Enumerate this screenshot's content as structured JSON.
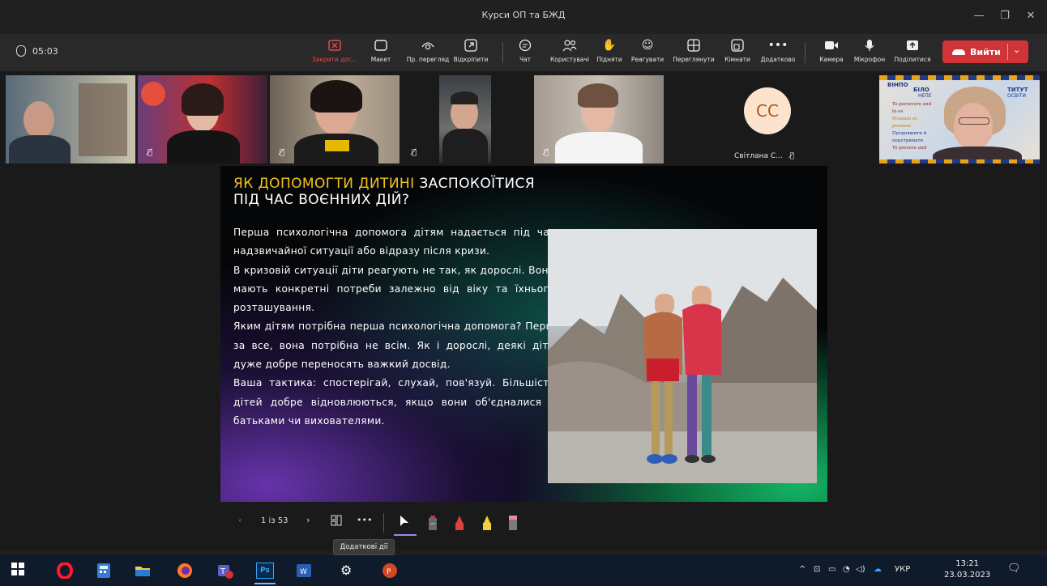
{
  "window": {
    "title": "Курси ОП та БЖД",
    "minimize": "—",
    "maximize": "❐",
    "close": "✕"
  },
  "meeting": {
    "timer": "05:03"
  },
  "toolbar": {
    "buttons": [
      {
        "label": "Закрити дос...",
        "icon": "close-share-icon"
      },
      {
        "label": "Макет",
        "icon": "layout-icon"
      },
      {
        "label": "Пр. перегляд",
        "icon": "preview-icon"
      },
      {
        "label": "Відкріпити",
        "icon": "popout-icon"
      },
      {
        "label": "Чат",
        "icon": "chat-icon"
      },
      {
        "label": "Користувачі",
        "icon": "people-icon"
      },
      {
        "label": "Підняти",
        "icon": "raise-hand-icon"
      },
      {
        "label": "Реагувати",
        "icon": "react-icon"
      },
      {
        "label": "Переглянути",
        "icon": "view-icon"
      },
      {
        "label": "Кімнати",
        "icon": "rooms-icon"
      },
      {
        "label": "Додатково",
        "icon": "more-icon"
      },
      {
        "label": "Камера",
        "icon": "camera-icon"
      },
      {
        "label": "Мікрофон",
        "icon": "mic-icon"
      },
      {
        "label": "Поділитися",
        "icon": "share-icon"
      }
    ],
    "leave_label": "Вийти",
    "leave_color": "#d13438"
  },
  "participants": {
    "avatar_initials": "CC",
    "avatar_name": "Світлана С...",
    "presenter_banner": "ВІНПО",
    "presenter_banner_2": "БІЛО",
    "presenter_banner_3": "ТИТУТ",
    "presenter_banner_4": "НЕПЕ",
    "presenter_banner_5": "ОСВІТИ",
    "presenter_slide_lines": [
      "To persevere and to es",
      "Prosiare ei, prosiare",
      "Продовжити й перетримати",
      "To perseve and"
    ]
  },
  "slide": {
    "title_highlight": "ЯК ДОПОМОГТИ ДИТИНІ",
    "title_rest": " ЗАСПОКОЇТИСЯ",
    "title_line2": "ПІД ЧАС ВОЄННИХ ДІЙ?",
    "paragraphs": [
      "Перша психологічна допомога дітям надається під час надзвичайної ситуації або відразу після кризи.",
      "В кризовій ситуації діти реагують не так, як дорослі. Вони мають конкретні потреби залежно від віку та їхнього розташування.",
      "Яким дітям потрібна перша психологічна допомога? Перш за все, вона потрібна не всім. Як і дорослі, деякі діти дуже добре переносять важкий досвід.",
      "Ваша тактика: спостерігай, слухай, пов'язуй. Більшість дітей добре відновлюються, якщо вони об'єдналися з батьками чи вихователями."
    ],
    "accent_color": "#f4c318"
  },
  "presenter": {
    "page_indicator": "1 із 53",
    "more_tooltip": "Додаткові дії"
  },
  "taskbar": {
    "language": "УКР",
    "time": "13:21",
    "date": "23.03.2023"
  }
}
